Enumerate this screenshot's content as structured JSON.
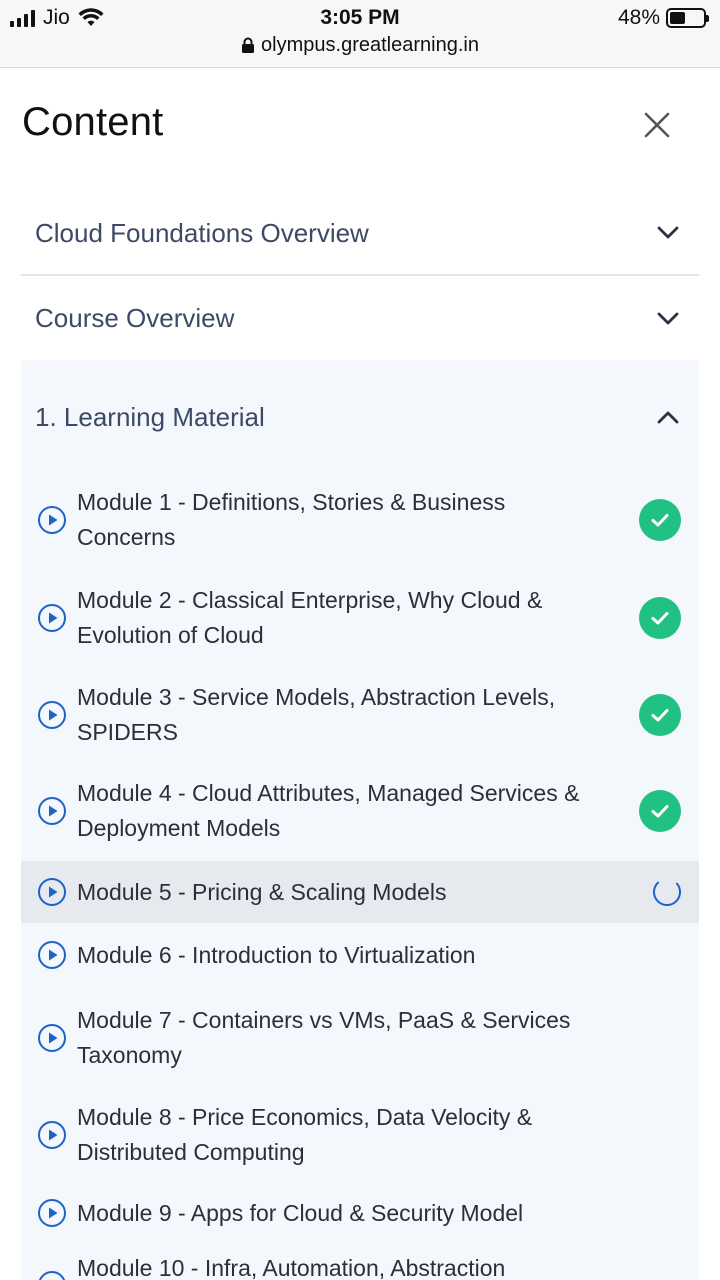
{
  "status_bar": {
    "carrier": "Jio",
    "time": "3:05 PM",
    "battery": "48%",
    "battery_level": 0.48,
    "url": "olympus.greatlearning.in"
  },
  "header": {
    "title": "Content"
  },
  "sections": [
    {
      "label": "Cloud Foundations Overview",
      "expanded": false
    },
    {
      "label": "Course Overview",
      "expanded": false
    },
    {
      "label": "1. Learning Material",
      "expanded": true
    }
  ],
  "modules": [
    {
      "line1": "Module 1 - Definitions, Stories & Business",
      "line2": "Concerns",
      "status": "completed"
    },
    {
      "line1": "Module 2 - Classical Enterprise, Why Cloud &",
      "line2": "Evolution of Cloud",
      "status": "completed"
    },
    {
      "line1": "Module 3 - Service Models, Abstraction Levels,",
      "line2": "SPIDERS",
      "status": "completed"
    },
    {
      "line1": "Module 4 - Cloud Attributes, Managed Services &",
      "line2": "Deployment Models",
      "status": "completed"
    },
    {
      "line1": "Module 5 - Pricing & Scaling Models",
      "line2": "",
      "status": "in-progress"
    },
    {
      "line1": "Module 6 - Introduction to Virtualization",
      "line2": "",
      "status": "none"
    },
    {
      "line1": "Module 7 - Containers vs VMs, PaaS & Services",
      "line2": "Taxonomy",
      "status": "none"
    },
    {
      "line1": "Module 8 - Price Economics, Data Velocity &",
      "line2": "Distributed Computing",
      "status": "none"
    },
    {
      "line1": "Module 9 - Apps for Cloud & Security Model",
      "line2": "",
      "status": "none"
    },
    {
      "line1": "Module 10 - Infra, Automation, Abstraction",
      "line2": "",
      "status": "none"
    }
  ],
  "colors": {
    "accent_blue": "#1e63c8",
    "completed_green": "#21c184",
    "section_text": "#3d4a66"
  }
}
